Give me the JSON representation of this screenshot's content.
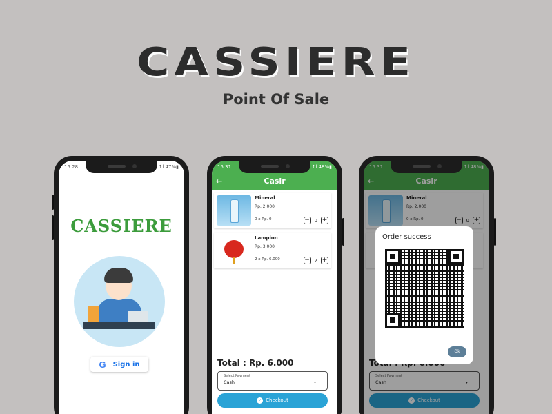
{
  "hero": {
    "title": "CASSIERE",
    "subtitle": "Point Of Sale"
  },
  "phone1": {
    "status_time": "15.28",
    "status_right": "▾.↑l 47%▮",
    "brand": "CASSIERE",
    "signin_icon": "G",
    "signin_label": "Sign in"
  },
  "phone2": {
    "status_time": "15.31",
    "status_right": "▾.↑l 48%▮",
    "appbar_title": "Casir",
    "back_icon": "←",
    "items": [
      {
        "name": "Mineral",
        "price": "Rp. 2.000",
        "subtotal": "0 x Rp. 0",
        "qty": "0"
      },
      {
        "name": "Lampion",
        "price": "Rp. 3.000",
        "subtotal": "2 x Rp. 6.000",
        "qty": "2"
      }
    ],
    "minus": "−",
    "plus": "+",
    "total": "Total : Rp. 6.000",
    "payment_label": "Select Payment",
    "payment_value": "Cash",
    "checkout_label": "Checkout",
    "check_icon": "✓",
    "dropdown_icon": "▾"
  },
  "phone3": {
    "status_time": "15.31",
    "status_right": "▾.↑l 48%▮",
    "dialog_title": "Order success",
    "ok_label": "Ok"
  },
  "colors": {
    "green": "#4caf50",
    "blue": "#2aa3d6",
    "background": "#c3c0bf"
  }
}
